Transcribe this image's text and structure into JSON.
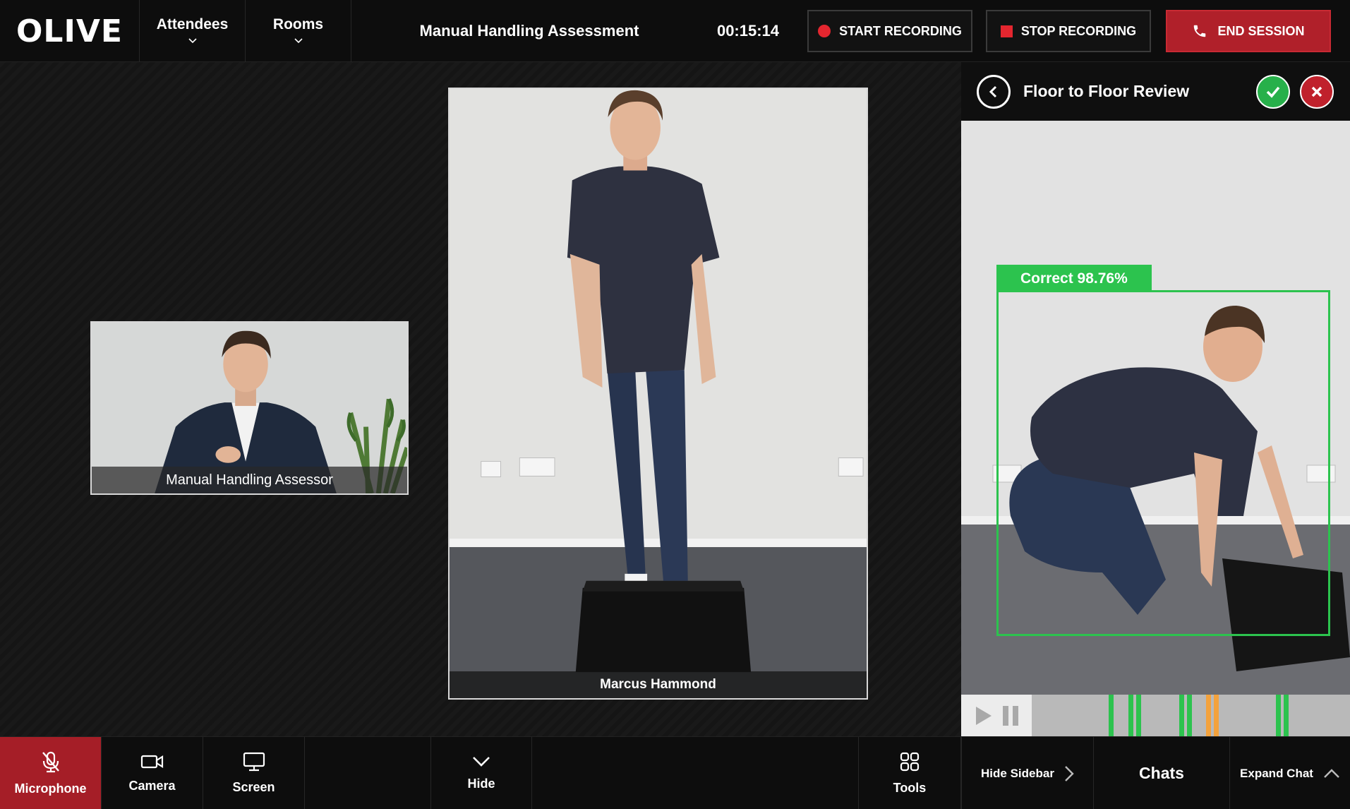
{
  "app": {
    "logo": "OLIVE",
    "session_title": "Manual Handling Assessment",
    "timer": "00:15:14"
  },
  "nav": {
    "attendees": "Attendees",
    "rooms": "Rooms"
  },
  "recording": {
    "start_label": "START RECORDING",
    "stop_label": "STOP RECORDING",
    "end_label": "END SESSION"
  },
  "tiles": {
    "assessor_name": "Manual Handling Assessor",
    "participant_name": "Marcus Hammond"
  },
  "sidebar": {
    "title": "Floor to Floor Review",
    "detection_label": "Correct 98.76%",
    "timeline_markers": [
      {
        "position_pct": 0.38,
        "status": "correct"
      },
      {
        "position_pct": 0.43,
        "status": "correct"
      },
      {
        "position_pct": 0.45,
        "status": "correct"
      },
      {
        "position_pct": 0.56,
        "status": "correct"
      },
      {
        "position_pct": 0.58,
        "status": "correct"
      },
      {
        "position_pct": 0.63,
        "status": "warning"
      },
      {
        "position_pct": 0.65,
        "status": "warning"
      },
      {
        "position_pct": 0.81,
        "status": "correct"
      },
      {
        "position_pct": 0.83,
        "status": "correct"
      }
    ]
  },
  "bottom_bar": {
    "microphone": "Microphone",
    "camera": "Camera",
    "screen": "Screen",
    "hide": "Hide",
    "tools": "Tools",
    "hide_sidebar": "Hide Sidebar",
    "chats": "Chats",
    "expand_chat": "Expand Chat"
  },
  "colors": {
    "accent_red": "#b0202a",
    "record_red": "#e4262f",
    "correct_green": "#2cc34e",
    "warning_orange": "#f3a23c"
  }
}
